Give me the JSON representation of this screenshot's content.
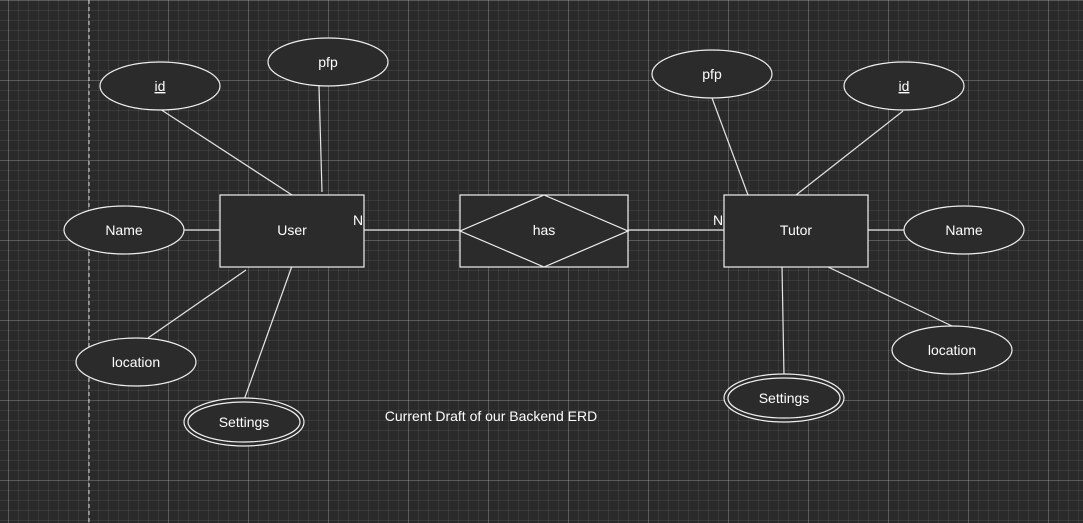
{
  "diagram": {
    "relationship": {
      "label": "has"
    },
    "user": {
      "label": "User",
      "cardinality": "N",
      "attributes": {
        "id": "id",
        "pfp": "pfp",
        "name": "Name",
        "location": "location",
        "settings": "Settings"
      }
    },
    "tutor": {
      "label": "Tutor",
      "cardinality": "N",
      "attributes": {
        "id": "id",
        "pfp": "pfp",
        "name": "Name",
        "location": "location",
        "settings": "Settings"
      }
    },
    "caption": "Current Draft of our Backend ERD"
  }
}
